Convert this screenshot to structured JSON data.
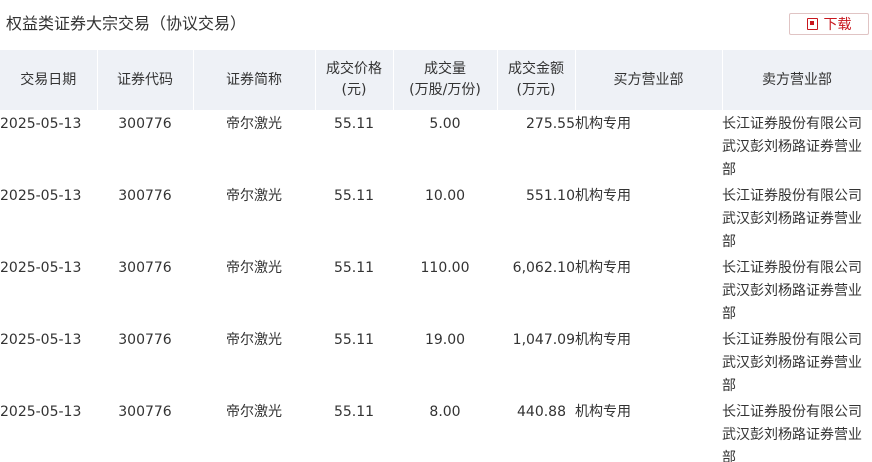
{
  "header": {
    "title": "权益类证券大宗交易（协议交易）",
    "download_label": "下载"
  },
  "table": {
    "columns": [
      "交易日期",
      "证券代码",
      "证券简称",
      "成交价格\n(元)",
      "成交量\n(万股/万份)",
      "成交金额\n(万元)",
      "买方营业部",
      "卖方营业部"
    ],
    "rows": [
      [
        "2025-05-13",
        "300776",
        "帝尔激光",
        "55.11",
        "5.00",
        "275.55",
        "机构专用",
        "长江证券股份有限公司武汉彭刘杨路证券营业部"
      ],
      [
        "2025-05-13",
        "300776",
        "帝尔激光",
        "55.11",
        "10.00",
        "551.10",
        "机构专用",
        "长江证券股份有限公司武汉彭刘杨路证券营业部"
      ],
      [
        "2025-05-13",
        "300776",
        "帝尔激光",
        "55.11",
        "110.00",
        "6,062.10",
        "机构专用",
        "长江证券股份有限公司武汉彭刘杨路证券营业部"
      ],
      [
        "2025-05-13",
        "300776",
        "帝尔激光",
        "55.11",
        "19.00",
        "1,047.09",
        "机构专用",
        "长江证券股份有限公司武汉彭刘杨路证券营业部"
      ],
      [
        "2025-05-13",
        "300776",
        "帝尔激光",
        "55.11",
        "8.00",
        "440.88",
        "机构专用",
        "长江证券股份有限公司武汉彭刘杨路证券营业部"
      ]
    ]
  },
  "colors": {
    "header_bg": "#eef1f6",
    "accent": "#c8161d",
    "text": "#333333"
  }
}
